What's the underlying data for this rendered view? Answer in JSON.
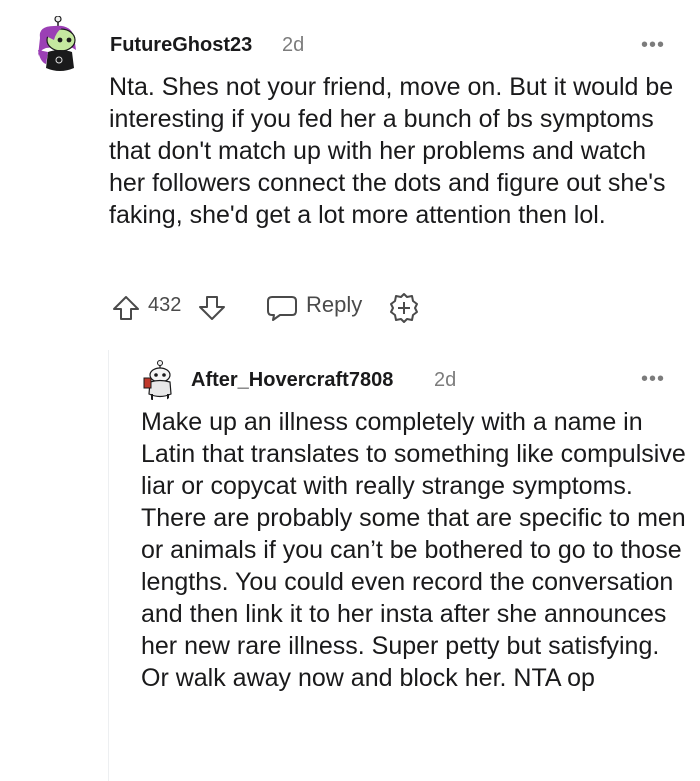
{
  "comment": {
    "username": "FutureGhost23",
    "age": "2d",
    "more_label": "•••",
    "body": "Nta. Shes not your friend, move on. But it would be interesting if you fed her a bunch of bs symptoms that don't match up with her problems and watch her followers connect the dots and figure out she's faking, she'd get a lot more attention then lol.",
    "score": "432",
    "reply_label": "Reply",
    "icons": [
      "upvote-icon",
      "downvote-icon",
      "reply-icon",
      "award-icon",
      "more-icon"
    ]
  },
  "reply": {
    "username": "After_Hovercraft7808",
    "age": "2d",
    "more_label": "•••",
    "body": "Make up an illness completely with a name in Latin that translates to something like compulsive liar or copycat with really strange symptoms. There are probably some that are specific to men or animals if you can’t be bothered to go to those lengths. You could even record the conversation and then link it to her insta after she announces her new rare illness. Super petty but satisfying. Or walk away now and block her. NTA op"
  },
  "colors": {
    "text": "#1a1a1b",
    "meta": "#7c7c7c",
    "action": "#4a4a4a",
    "thread_line": "#edeff1",
    "avatar1_hair": "#9b3fb5",
    "avatar1_face": "#c5e8a0"
  }
}
